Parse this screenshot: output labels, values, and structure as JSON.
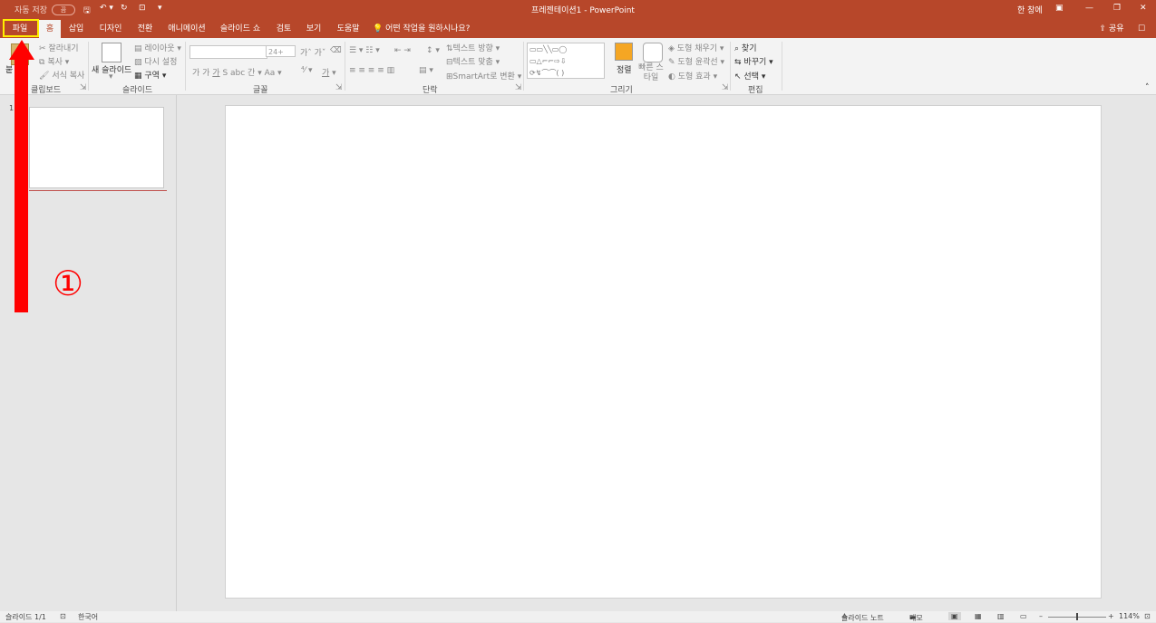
{
  "titlebar": {
    "autosave": "자동 저장",
    "autosave_toggle": "끔",
    "document_title": "프레젠테이션1 - PowerPoint",
    "window_mode": "한 창에"
  },
  "tabs": [
    "파일",
    "홈",
    "삽입",
    "디자인",
    "전환",
    "애니메이션",
    "슬라이드 쇼",
    "검토",
    "보기",
    "도움말"
  ],
  "tell_me": "어떤 작업을 원하시나요?",
  "share_label": "공유",
  "ribbon": {
    "clipboard": {
      "label": "클립보드",
      "paste": "붙",
      "cut": "잘라내기",
      "copy": "복사",
      "format_painter": "서식 복사"
    },
    "slides": {
      "label": "슬라이드",
      "new_slide": "새 슬라이드",
      "layout": "레이아웃",
      "reset": "다시 설정",
      "section": "구역"
    },
    "font": {
      "label": "글꼴",
      "size": "24+"
    },
    "paragraph": {
      "label": "단락",
      "text_direction": "텍스트 방향",
      "align_text": "텍스트 맞춤",
      "smartart": "SmartArt로 변환"
    },
    "drawing": {
      "label": "그리기",
      "arrange": "정렬",
      "quick_styles": "빠른 스타일",
      "shape_fill": "도형 채우기",
      "shape_outline": "도형 윤곽선",
      "shape_effects": "도형 효과"
    },
    "editing": {
      "label": "편집",
      "find": "찾기",
      "replace": "바꾸기",
      "select": "선택"
    }
  },
  "thumbnail_number": "1",
  "annotation": "①",
  "status": {
    "slide_count": "슬라이드 1/1",
    "language": "한국어",
    "notes": "슬라이드 노트",
    "comments": "메모",
    "zoom": "114%"
  }
}
